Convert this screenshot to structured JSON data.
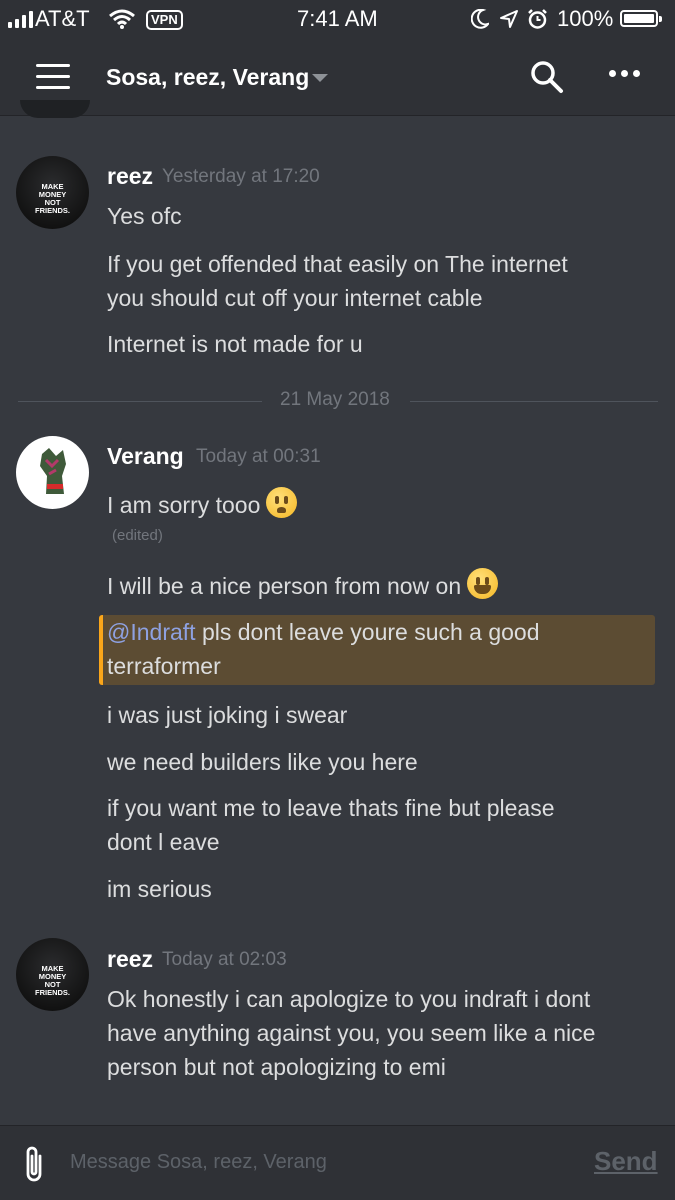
{
  "status_bar": {
    "carrier": "AT&T",
    "vpn": "VPN",
    "time": "7:41 AM",
    "battery": "100%",
    "icons": [
      "signal-bars-icon",
      "wifi-icon",
      "vpn-badge",
      "moon-icon",
      "location-arrow-icon",
      "alarm-icon",
      "battery-icon"
    ]
  },
  "header": {
    "channel": "Sosa, reez, Verang",
    "icons": [
      "hamburger-menu-icon",
      "chevron-down-icon",
      "search-icon",
      "more-icon"
    ]
  },
  "messages": [
    {
      "author": "reez",
      "timestamp": "Yesterday at 17:20",
      "lines": [
        "Yes ofc",
        "If you get offended that easily on The internet",
        "you should cut off your internet cable",
        "Internet is not made for u"
      ]
    },
    {
      "author": "Verang",
      "timestamp": "Today at 00:31",
      "line1": "I am sorry tooo",
      "edited": "(edited)",
      "line2": "I will be a nice person from now on",
      "mention": "@Indraft",
      "mention_rest": " pls dont leave youre such a good",
      "mention_line2": "terraformer",
      "lines": [
        "i was just joking i swear",
        "we need builders like you here",
        "if you want me to leave thats fine but please",
        "dont l eave",
        "im serious"
      ]
    },
    {
      "author": "reez",
      "timestamp": "Today at 02:03",
      "lines": [
        "Ok honestly i can apologize to you indraft i dont",
        "have anything against you, you seem like a nice",
        "person but not apologizing to emi"
      ]
    }
  ],
  "avatar_text": {
    "reez": "MAKE MONEY NOT FRIENDS."
  },
  "date_divider": "21 May 2018",
  "composer": {
    "placeholder": "Message Sosa, reez, Verang",
    "send_label": "Send"
  },
  "colors": {
    "background": "#36393f",
    "header": "#2f3136",
    "mention_bg": "#5c4c33",
    "mention_border": "#faa61a",
    "mention_text": "#8ea1e1"
  }
}
